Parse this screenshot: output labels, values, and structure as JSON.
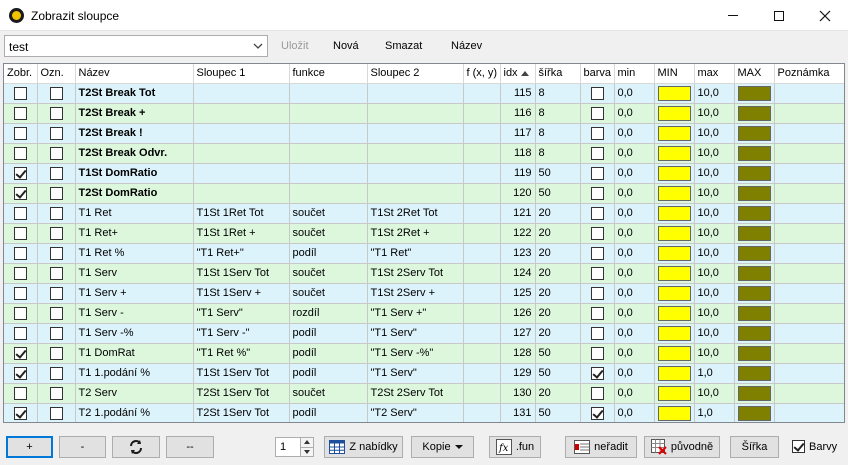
{
  "window": {
    "title": "Zobrazit sloupce"
  },
  "toolbar": {
    "combo_value": "test",
    "save_label": "Uložit",
    "new_label": "Nová",
    "delete_label": "Smazat",
    "name_label": "Název"
  },
  "columns": [
    "Zobr.",
    "Ozn.",
    "Název",
    "Sloupec 1",
    "funkce",
    "Sloupec 2",
    "f (x, y)",
    "idx",
    "šířka",
    "barva",
    "min",
    "MIN",
    "max",
    "MAX",
    "Poznámka"
  ],
  "colors": {
    "min_swatch": "#ffff00",
    "max_swatch": "#808000",
    "row_blue": "#dcf3fc",
    "row_green": "#ddf7dd"
  },
  "rows": [
    {
      "zobr": false,
      "ozn": false,
      "nazev": "T2St Break Tot",
      "bold": true,
      "s1": "",
      "fn": "",
      "s2": "",
      "fxy": "",
      "idx": "115",
      "sirka": "8",
      "barva": false,
      "min": "0,0",
      "max": "10,0"
    },
    {
      "zobr": false,
      "ozn": false,
      "nazev": "T2St Break +",
      "bold": true,
      "s1": "",
      "fn": "",
      "s2": "",
      "fxy": "",
      "idx": "116",
      "sirka": "8",
      "barva": false,
      "min": "0,0",
      "max": "10,0"
    },
    {
      "zobr": false,
      "ozn": false,
      "nazev": "T2St Break !",
      "bold": true,
      "s1": "",
      "fn": "",
      "s2": "",
      "fxy": "",
      "idx": "117",
      "sirka": "8",
      "barva": false,
      "min": "0,0",
      "max": "10,0"
    },
    {
      "zobr": false,
      "ozn": false,
      "nazev": "T2St Break Odvr.",
      "bold": true,
      "s1": "",
      "fn": "",
      "s2": "",
      "fxy": "",
      "idx": "118",
      "sirka": "8",
      "barva": false,
      "min": "0,0",
      "max": "10,0"
    },
    {
      "zobr": true,
      "ozn": false,
      "nazev": "T1St DomRatio",
      "bold": true,
      "s1": "",
      "fn": "",
      "s2": "",
      "fxy": "",
      "idx": "119",
      "sirka": "50",
      "barva": false,
      "min": "0,0",
      "max": "10,0"
    },
    {
      "zobr": true,
      "ozn": false,
      "nazev": "T2St DomRatio",
      "bold": true,
      "s1": "",
      "fn": "",
      "s2": "",
      "fxy": "",
      "idx": "120",
      "sirka": "50",
      "barva": false,
      "min": "0,0",
      "max": "10,0"
    },
    {
      "zobr": false,
      "ozn": false,
      "nazev": "T1 Ret",
      "bold": false,
      "s1": "T1St 1Ret Tot",
      "fn": "součet",
      "s2": "T1St 2Ret Tot",
      "fxy": "",
      "idx": "121",
      "sirka": "20",
      "barva": false,
      "min": "0,0",
      "max": "10,0"
    },
    {
      "zobr": false,
      "ozn": false,
      "nazev": "T1 Ret+",
      "bold": false,
      "s1": "T1St 1Ret +",
      "fn": "součet",
      "s2": "T1St 2Ret +",
      "fxy": "",
      "idx": "122",
      "sirka": "20",
      "barva": false,
      "min": "0,0",
      "max": "10,0"
    },
    {
      "zobr": false,
      "ozn": false,
      "nazev": "T1 Ret %",
      "bold": false,
      "s1": "\"T1 Ret+\"",
      "fn": "podíl",
      "s2": "\"T1 Ret\"",
      "fxy": "",
      "idx": "123",
      "sirka": "20",
      "barva": false,
      "min": "0,0",
      "max": "10,0"
    },
    {
      "zobr": false,
      "ozn": false,
      "nazev": "T1 Serv",
      "bold": false,
      "s1": "T1St 1Serv Tot",
      "fn": "součet",
      "s2": "T1St 2Serv Tot",
      "fxy": "",
      "idx": "124",
      "sirka": "20",
      "barva": false,
      "min": "0,0",
      "max": "10,0"
    },
    {
      "zobr": false,
      "ozn": false,
      "nazev": "T1 Serv +",
      "bold": false,
      "s1": "T1St 1Serv +",
      "fn": "součet",
      "s2": "T1St 2Serv +",
      "fxy": "",
      "idx": "125",
      "sirka": "20",
      "barva": false,
      "min": "0,0",
      "max": "10,0"
    },
    {
      "zobr": false,
      "ozn": false,
      "nazev": "T1 Serv -",
      "bold": false,
      "s1": "\"T1 Serv\"",
      "fn": "rozdíl",
      "s2": "\"T1 Serv +\"",
      "fxy": "",
      "idx": "126",
      "sirka": "20",
      "barva": false,
      "min": "0,0",
      "max": "10,0"
    },
    {
      "zobr": false,
      "ozn": false,
      "nazev": "T1 Serv -%",
      "bold": false,
      "s1": "\"T1 Serv -\"",
      "fn": "podíl",
      "s2": "\"T1 Serv\"",
      "fxy": "",
      "idx": "127",
      "sirka": "20",
      "barva": false,
      "min": "0,0",
      "max": "10,0"
    },
    {
      "zobr": true,
      "ozn": false,
      "nazev": "T1 DomRat",
      "bold": false,
      "s1": "\"T1 Ret %\"",
      "fn": "podíl",
      "s2": "\"T1 Serv -%\"",
      "fxy": "",
      "idx": "128",
      "sirka": "50",
      "barva": false,
      "min": "0,0",
      "max": "10,0"
    },
    {
      "zobr": true,
      "ozn": false,
      "nazev": "T1 1.podání %",
      "bold": false,
      "s1": "T1St 1Serv Tot",
      "fn": "podíl",
      "s2": "\"T1 Serv\"",
      "fxy": "",
      "idx": "129",
      "sirka": "50",
      "barva": true,
      "min": "0,0",
      "max": "1,0"
    },
    {
      "zobr": false,
      "ozn": false,
      "nazev": "T2 Serv",
      "bold": false,
      "s1": "T2St 1Serv Tot",
      "fn": "součet",
      "s2": "T2St 2Serv Tot",
      "fxy": "",
      "idx": "130",
      "sirka": "20",
      "barva": false,
      "min": "0,0",
      "max": "10,0"
    },
    {
      "zobr": true,
      "ozn": false,
      "nazev": "T2 1.podání %",
      "bold": false,
      "s1": "T2St 1Serv Tot",
      "fn": "podíl",
      "s2": "\"T2 Serv\"",
      "fxy": "",
      "idx": "131",
      "sirka": "50",
      "barva": true,
      "min": "0,0",
      "max": "1,0"
    }
  ],
  "bottom": {
    "add_label": "+",
    "remove_label": "-",
    "clear_label": "--",
    "spin_value": "1",
    "from_menu_label": "Z nabídky",
    "copy_label": "Kopie",
    "fun_label": ".fun",
    "nosort_label": "neřadit",
    "original_label": "původně",
    "width_label": "Šířka",
    "colors_label": "Barvy",
    "colors_checked": true
  }
}
